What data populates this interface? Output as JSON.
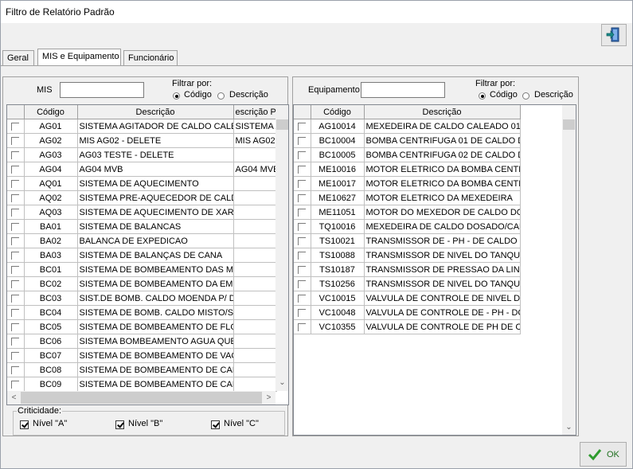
{
  "window": {
    "title": "Filtro de Relatório Padrão"
  },
  "tabs": [
    {
      "label": "Geral",
      "active": false
    },
    {
      "label": "MIS e Equipamento",
      "active": true
    },
    {
      "label": "Funcionário",
      "active": false
    }
  ],
  "mis_panel": {
    "search_label": "MIS",
    "search_value": "",
    "filter_label": "Filtrar por:",
    "radio_codigo": "Código",
    "radio_descricao": "Descrição",
    "selected_filter": "Código",
    "columns": [
      "",
      "Código",
      "Descrição",
      "escrição PI"
    ],
    "rows": [
      {
        "codigo": "AG01",
        "descricao": "SISTEMA AGITADOR DE CALDO CALE",
        "extra": "SISTEMA A"
      },
      {
        "codigo": "AG02",
        "descricao": "MIS AG02 - DELETE",
        "extra": "MIS AG02"
      },
      {
        "codigo": "AG03",
        "descricao": "AG03 TESTE - DELETE",
        "extra": ""
      },
      {
        "codigo": "AG04",
        "descricao": "AG04 MVB",
        "extra": "AG04 MVE"
      },
      {
        "codigo": "AQ01",
        "descricao": "SISTEMA DE AQUECIMENTO",
        "extra": ""
      },
      {
        "codigo": "AQ02",
        "descricao": "SISTEMA PRE-AQUECEDOR DE CALD",
        "extra": ""
      },
      {
        "codigo": "AQ03",
        "descricao": "SISTEMA DE AQUECIMENTO DE XARO",
        "extra": ""
      },
      {
        "codigo": "BA01",
        "descricao": "SISTEMA DE BALANCAS",
        "extra": ""
      },
      {
        "codigo": "BA02",
        "descricao": "BALANCA DE EXPEDICAO",
        "extra": ""
      },
      {
        "codigo": "BA03",
        "descricao": "SISTEMA DE BALANÇAS DE CANA",
        "extra": ""
      },
      {
        "codigo": "BC01",
        "descricao": "SISTEMA DE BOMBEAMENTO DAS MO",
        "extra": ""
      },
      {
        "codigo": "BC02",
        "descricao": "SISTEMA DE BOMBEAMENTO DA EME",
        "extra": ""
      },
      {
        "codigo": "BC03",
        "descricao": "SIST.DE BOMB. CALDO MOENDA P/ D",
        "extra": ""
      },
      {
        "codigo": "BC04",
        "descricao": "SISTEMA DE BOMB. CALDO MISTO/SU",
        "extra": ""
      },
      {
        "codigo": "BC05",
        "descricao": "SISTEMA DE BOMBEAMENTO DE FLO",
        "extra": ""
      },
      {
        "codigo": "BC06",
        "descricao": "SISTEMA BOMBEAMENTO AGUA QUE",
        "extra": ""
      },
      {
        "codigo": "BC07",
        "descricao": "SISTEMA DE BOMBEAMENTO DE VAC",
        "extra": ""
      },
      {
        "codigo": "BC08",
        "descricao": "SISTEMA DE BOMBEAMENTO DE CAL",
        "extra": ""
      },
      {
        "codigo": "BC09",
        "descricao": "SISTEMA DE BOMBEAMENTO DE CAL",
        "extra": ""
      }
    ]
  },
  "criticidade": {
    "label": "Criticidade:",
    "nivel_a": "Nível \"A\"",
    "nivel_b": "Nível \"B\"",
    "nivel_c": "Nível \"C\""
  },
  "equip_panel": {
    "search_label": "Equipamento",
    "search_value": "",
    "filter_label": "Filtrar por:",
    "radio_codigo": "Código",
    "radio_descricao": "Descrição",
    "selected_filter": "Código",
    "columns": [
      "",
      "Código",
      "Descrição"
    ],
    "rows": [
      {
        "codigo": "AG10014",
        "descricao": "MEXEDEIRA DE CALDO CALEADO 01"
      },
      {
        "codigo": "BC10004",
        "descricao": "BOMBA CENTRIFUGA 01 DE CALDO D"
      },
      {
        "codigo": "BC10005",
        "descricao": "BOMBA CENTRIFUGA 02 DE CALDO D"
      },
      {
        "codigo": "ME10016",
        "descricao": "MOTOR ELETRICO DA BOMBA CENTF"
      },
      {
        "codigo": "ME10017",
        "descricao": "MOTOR ELETRICO DA BOMBA CENTF"
      },
      {
        "codigo": "ME10627",
        "descricao": "MOTOR ELETRICO DA MEXEDEIRA"
      },
      {
        "codigo": "ME11051",
        "descricao": "MOTOR DO MEXEDOR DE CALDO DO"
      },
      {
        "codigo": "TQ10016",
        "descricao": "MEXEDEIRA DE CALDO DOSADO/CAL"
      },
      {
        "codigo": "TS10021",
        "descricao": "TRANSMISSOR DE - PH - DE CALDO C"
      },
      {
        "codigo": "TS10088",
        "descricao": "TRANSMISSOR DE NIVEL DO TANQU"
      },
      {
        "codigo": "TS10187",
        "descricao": "TRANSMISSOR DE PRESSAO DA LINH"
      },
      {
        "codigo": "TS10256",
        "descricao": "TRANSMISSOR DE NIVEL DO TANQUI"
      },
      {
        "codigo": "VC10015",
        "descricao": "VALVULA DE CONTROLE DE NIVEL DU"
      },
      {
        "codigo": "VC10048",
        "descricao": "VALVULA DE CONTROLE DE - PH - DC"
      },
      {
        "codigo": "VC10355",
        "descricao": "VALVULA DE CONTROLE  DE PH DE C"
      }
    ]
  },
  "ok_button": {
    "label": "OK"
  },
  "colors": {
    "check_green": "#2e9b2e",
    "exit_icon_teal": "#1a8a8a"
  }
}
